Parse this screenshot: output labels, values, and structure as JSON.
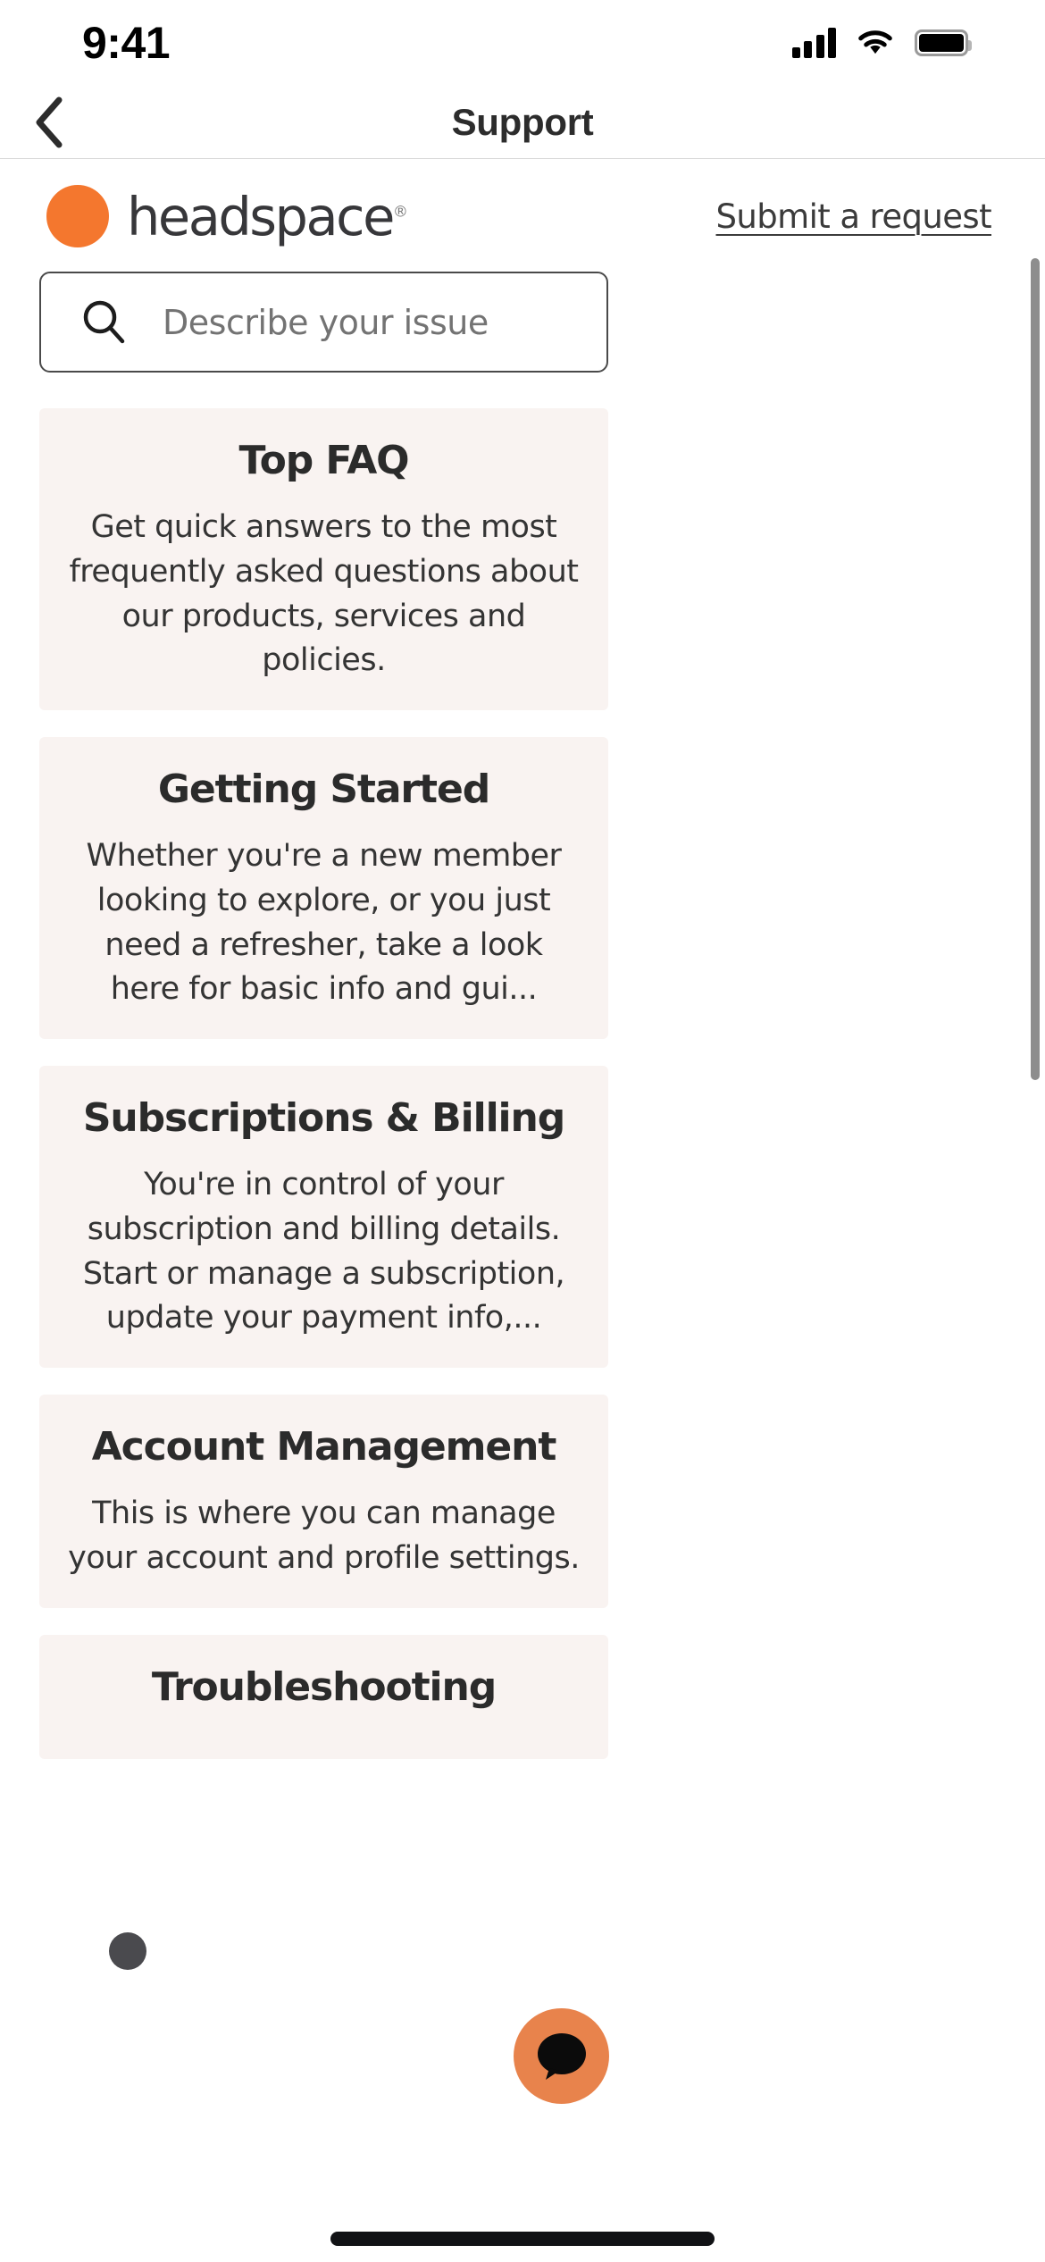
{
  "status_bar": {
    "time": "9:41",
    "signal_icon": "cellular-signal-icon",
    "wifi_icon": "wifi-icon",
    "battery_icon": "battery-full-icon"
  },
  "nav_bar": {
    "back_icon": "chevron-left-icon",
    "title": "Support"
  },
  "brand": {
    "logo_mark": "headspace-orange-dot-icon",
    "name": "headspace",
    "registered_mark": "®",
    "submit_request_label": "Submit a request"
  },
  "search": {
    "icon": "search-icon",
    "placeholder": "Describe your issue",
    "value": ""
  },
  "cards": [
    {
      "title": "Top FAQ",
      "description": "Get quick answers to the most frequently asked questions about our products, services and policies."
    },
    {
      "title": "Getting Started",
      "description": "Whether you're a new member looking to explore, or you just need a refresher, take a look here for basic info and gui..."
    },
    {
      "title": "Subscriptions & Billing",
      "description": "You're in control of your subscription and billing details. Start or manage a subscription, update your payment info,..."
    },
    {
      "title": "Account Management",
      "description": "This is where you can manage your account and profile settings."
    },
    {
      "title": "Troubleshooting",
      "description": ""
    }
  ],
  "chat_button": {
    "icon": "chat-bubble-icon",
    "label": ""
  },
  "colors": {
    "brand_orange": "#F4772E",
    "chat_fab_orange": "#E8834C",
    "card_background": "#f9f3f1",
    "text_primary": "#2b2b2b",
    "text_secondary": "#343434",
    "placeholder": "#737373"
  }
}
